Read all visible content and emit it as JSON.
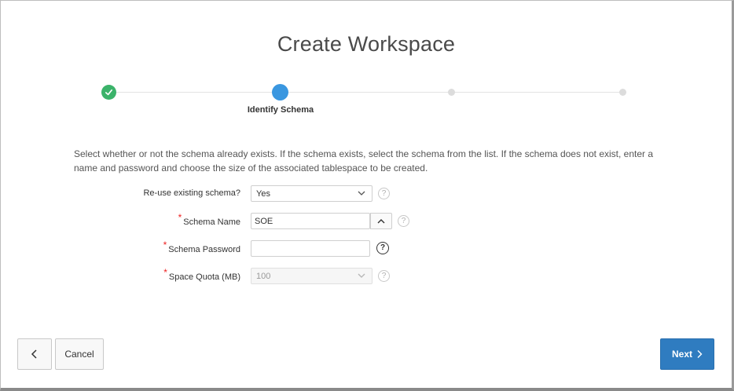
{
  "page": {
    "title": "Create Workspace"
  },
  "wizard": {
    "current_step_label": "Identify Schema",
    "steps": [
      {
        "status": "complete",
        "icon": "check-icon"
      },
      {
        "status": "current"
      },
      {
        "status": "future"
      },
      {
        "status": "future"
      }
    ],
    "colors": {
      "complete": "#3bb36a",
      "current": "#3a97e0",
      "future": "#dcdcdc"
    }
  },
  "description": "Select whether or not the schema already exists. If the schema exists, select the schema from the list. If the schema does not exist, enter a name and password and choose the size of the associated tablespace to be created.",
  "form": {
    "reuse_schema": {
      "label": "Re-use existing schema?",
      "value": "Yes",
      "required": false
    },
    "schema_name": {
      "label": "Schema Name",
      "value": "SOE",
      "required": true
    },
    "schema_password": {
      "label": "Schema Password",
      "value": "",
      "required": true
    },
    "space_quota": {
      "label": "Space Quota (MB)",
      "value": "100",
      "required": true,
      "disabled": true
    },
    "required_marker": "*",
    "help_glyph": "?"
  },
  "buttons": {
    "cancel_label": "Cancel",
    "next_label": "Next",
    "next_color": "#2f7cc0"
  }
}
